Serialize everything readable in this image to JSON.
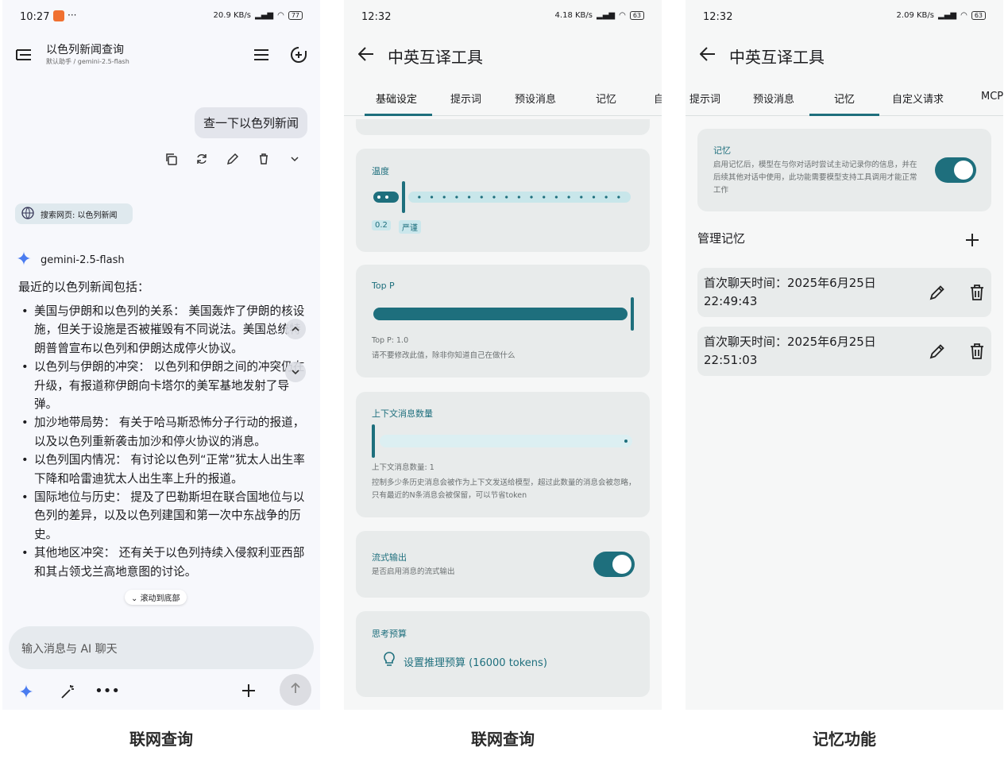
{
  "captions": [
    "联网查询",
    "联网查询",
    "记忆功能"
  ],
  "phone1": {
    "status": {
      "time": "10:27",
      "net": "20.9 KB/s",
      "battery": "77"
    },
    "title": "以色列新闻查询",
    "subtitle": "默认助手 / gemini-2.5-flash",
    "user_message": "查一下以色列新闻",
    "search_chip": "搜索网页: 以色列新闻",
    "model_name": "gemini-2.5-flash",
    "intro": "最近的以色列新闻包括：",
    "bullets": [
      "美国与伊朗和以色列的关系： 美国轰炸了伊朗的核设施，但关于设施是否被摧毁有不同说法。美国总统特朗普曾宣布以色列和伊朗达成停火协议。",
      "以色列与伊朗的冲突： 以色列和伊朗之间的冲突仍在升级，有报道称伊朗向卡塔尔的美军基地发射了导弹。",
      "加沙地带局势： 有关于哈马斯恐怖分子行动的报道，以及以色列重新袭击加沙和停火协议的消息。",
      "以色列国内情况： 有讨论以色列“正常”犹太人出生率下降和哈雷迪犹太人出生率上升的报道。",
      "国际地位与历史： 提及了巴勒斯坦在联合国地位与以色列的差异，以及以色列建国和第一次中东战争的历史。",
      "其他地区冲突： 还有关于以色列持续入侵叙利亚西部和其占领戈兰高地意图的讨论。"
    ],
    "scroll_chip": "滚动到底部",
    "input_placeholder": "输入消息与 AI 聊天"
  },
  "phone2": {
    "status": {
      "time": "12:32",
      "net": "4.18 KB/s",
      "battery": "63"
    },
    "title": "中英互译工具",
    "tabs": [
      "基础设定",
      "提示词",
      "预设消息",
      "记忆",
      "自"
    ],
    "temperature": {
      "title": "温度",
      "value": "0.2",
      "tag": "严谨",
      "level": 0.2
    },
    "top_p": {
      "title": "Top P",
      "value_label": "Top P: 1.0",
      "warning": "请不要修改此值，除非你知道自己在做什么",
      "level": 1.0
    },
    "context": {
      "title": "上下文消息数量",
      "value_label": "上下文消息数量: 1",
      "desc": "控制多少条历史消息会被作为上下文发送给模型，超过此数量的消息会被忽略，只有最近的N条消息会被保留，可以节省token",
      "level": 0.0
    },
    "stream": {
      "title": "流式输出",
      "desc": "是否启用消息的流式输出",
      "on": true
    },
    "thinking": {
      "title": "思考预算",
      "button": "设置推理预算 (16000 tokens)"
    }
  },
  "phone3": {
    "status": {
      "time": "12:32",
      "net": "2.09 KB/s",
      "battery": "63"
    },
    "title": "中英互译工具",
    "tabs": [
      "提示词",
      "预设消息",
      "记忆",
      "自定义请求",
      "MCP"
    ],
    "memory": {
      "title": "记忆",
      "desc": "启用记忆后，模型在与你对话时尝试主动记录你的信息，并在后续其他对话中使用，此功能需要模型支持工具调用才能正常工作",
      "on": true
    },
    "manage_title": "管理记忆",
    "records": [
      {
        "line1": "首次聊天时间：2025年6月25日",
        "line2": "22:49:43"
      },
      {
        "line1": "首次聊天时间：2025年6月25日",
        "line2": "22:51:03"
      }
    ]
  },
  "colors": {
    "accent": "#1e6f7d",
    "card": "#e8ebeb"
  }
}
